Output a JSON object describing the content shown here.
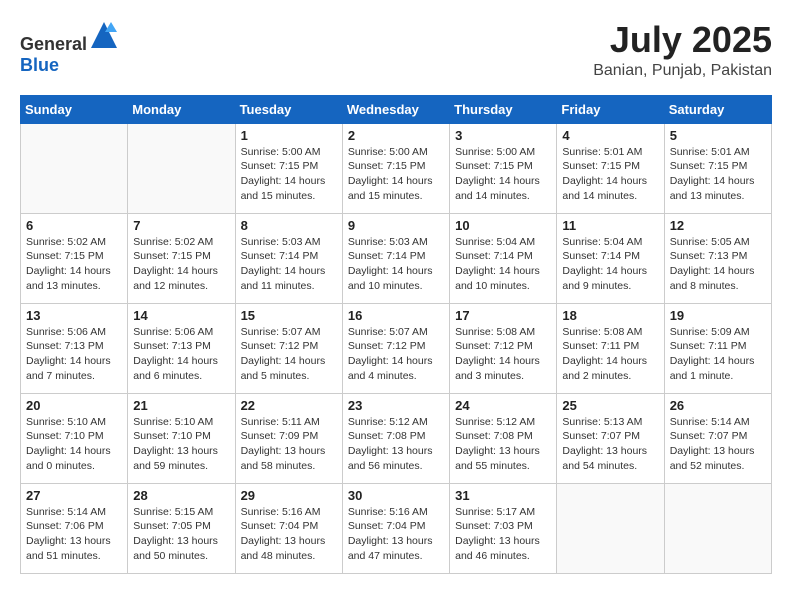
{
  "header": {
    "logo_general": "General",
    "logo_blue": "Blue",
    "month": "July 2025",
    "location": "Banian, Punjab, Pakistan"
  },
  "days_of_week": [
    "Sunday",
    "Monday",
    "Tuesday",
    "Wednesday",
    "Thursday",
    "Friday",
    "Saturday"
  ],
  "weeks": [
    [
      {
        "day": "",
        "info": ""
      },
      {
        "day": "",
        "info": ""
      },
      {
        "day": "1",
        "info": "Sunrise: 5:00 AM\nSunset: 7:15 PM\nDaylight: 14 hours\nand 15 minutes."
      },
      {
        "day": "2",
        "info": "Sunrise: 5:00 AM\nSunset: 7:15 PM\nDaylight: 14 hours\nand 15 minutes."
      },
      {
        "day": "3",
        "info": "Sunrise: 5:00 AM\nSunset: 7:15 PM\nDaylight: 14 hours\nand 14 minutes."
      },
      {
        "day": "4",
        "info": "Sunrise: 5:01 AM\nSunset: 7:15 PM\nDaylight: 14 hours\nand 14 minutes."
      },
      {
        "day": "5",
        "info": "Sunrise: 5:01 AM\nSunset: 7:15 PM\nDaylight: 14 hours\nand 13 minutes."
      }
    ],
    [
      {
        "day": "6",
        "info": "Sunrise: 5:02 AM\nSunset: 7:15 PM\nDaylight: 14 hours\nand 13 minutes."
      },
      {
        "day": "7",
        "info": "Sunrise: 5:02 AM\nSunset: 7:15 PM\nDaylight: 14 hours\nand 12 minutes."
      },
      {
        "day": "8",
        "info": "Sunrise: 5:03 AM\nSunset: 7:14 PM\nDaylight: 14 hours\nand 11 minutes."
      },
      {
        "day": "9",
        "info": "Sunrise: 5:03 AM\nSunset: 7:14 PM\nDaylight: 14 hours\nand 10 minutes."
      },
      {
        "day": "10",
        "info": "Sunrise: 5:04 AM\nSunset: 7:14 PM\nDaylight: 14 hours\nand 10 minutes."
      },
      {
        "day": "11",
        "info": "Sunrise: 5:04 AM\nSunset: 7:14 PM\nDaylight: 14 hours\nand 9 minutes."
      },
      {
        "day": "12",
        "info": "Sunrise: 5:05 AM\nSunset: 7:13 PM\nDaylight: 14 hours\nand 8 minutes."
      }
    ],
    [
      {
        "day": "13",
        "info": "Sunrise: 5:06 AM\nSunset: 7:13 PM\nDaylight: 14 hours\nand 7 minutes."
      },
      {
        "day": "14",
        "info": "Sunrise: 5:06 AM\nSunset: 7:13 PM\nDaylight: 14 hours\nand 6 minutes."
      },
      {
        "day": "15",
        "info": "Sunrise: 5:07 AM\nSunset: 7:12 PM\nDaylight: 14 hours\nand 5 minutes."
      },
      {
        "day": "16",
        "info": "Sunrise: 5:07 AM\nSunset: 7:12 PM\nDaylight: 14 hours\nand 4 minutes."
      },
      {
        "day": "17",
        "info": "Sunrise: 5:08 AM\nSunset: 7:12 PM\nDaylight: 14 hours\nand 3 minutes."
      },
      {
        "day": "18",
        "info": "Sunrise: 5:08 AM\nSunset: 7:11 PM\nDaylight: 14 hours\nand 2 minutes."
      },
      {
        "day": "19",
        "info": "Sunrise: 5:09 AM\nSunset: 7:11 PM\nDaylight: 14 hours\nand 1 minute."
      }
    ],
    [
      {
        "day": "20",
        "info": "Sunrise: 5:10 AM\nSunset: 7:10 PM\nDaylight: 14 hours\nand 0 minutes."
      },
      {
        "day": "21",
        "info": "Sunrise: 5:10 AM\nSunset: 7:10 PM\nDaylight: 13 hours\nand 59 minutes."
      },
      {
        "day": "22",
        "info": "Sunrise: 5:11 AM\nSunset: 7:09 PM\nDaylight: 13 hours\nand 58 minutes."
      },
      {
        "day": "23",
        "info": "Sunrise: 5:12 AM\nSunset: 7:08 PM\nDaylight: 13 hours\nand 56 minutes."
      },
      {
        "day": "24",
        "info": "Sunrise: 5:12 AM\nSunset: 7:08 PM\nDaylight: 13 hours\nand 55 minutes."
      },
      {
        "day": "25",
        "info": "Sunrise: 5:13 AM\nSunset: 7:07 PM\nDaylight: 13 hours\nand 54 minutes."
      },
      {
        "day": "26",
        "info": "Sunrise: 5:14 AM\nSunset: 7:07 PM\nDaylight: 13 hours\nand 52 minutes."
      }
    ],
    [
      {
        "day": "27",
        "info": "Sunrise: 5:14 AM\nSunset: 7:06 PM\nDaylight: 13 hours\nand 51 minutes."
      },
      {
        "day": "28",
        "info": "Sunrise: 5:15 AM\nSunset: 7:05 PM\nDaylight: 13 hours\nand 50 minutes."
      },
      {
        "day": "29",
        "info": "Sunrise: 5:16 AM\nSunset: 7:04 PM\nDaylight: 13 hours\nand 48 minutes."
      },
      {
        "day": "30",
        "info": "Sunrise: 5:16 AM\nSunset: 7:04 PM\nDaylight: 13 hours\nand 47 minutes."
      },
      {
        "day": "31",
        "info": "Sunrise: 5:17 AM\nSunset: 7:03 PM\nDaylight: 13 hours\nand 46 minutes."
      },
      {
        "day": "",
        "info": ""
      },
      {
        "day": "",
        "info": ""
      }
    ]
  ]
}
